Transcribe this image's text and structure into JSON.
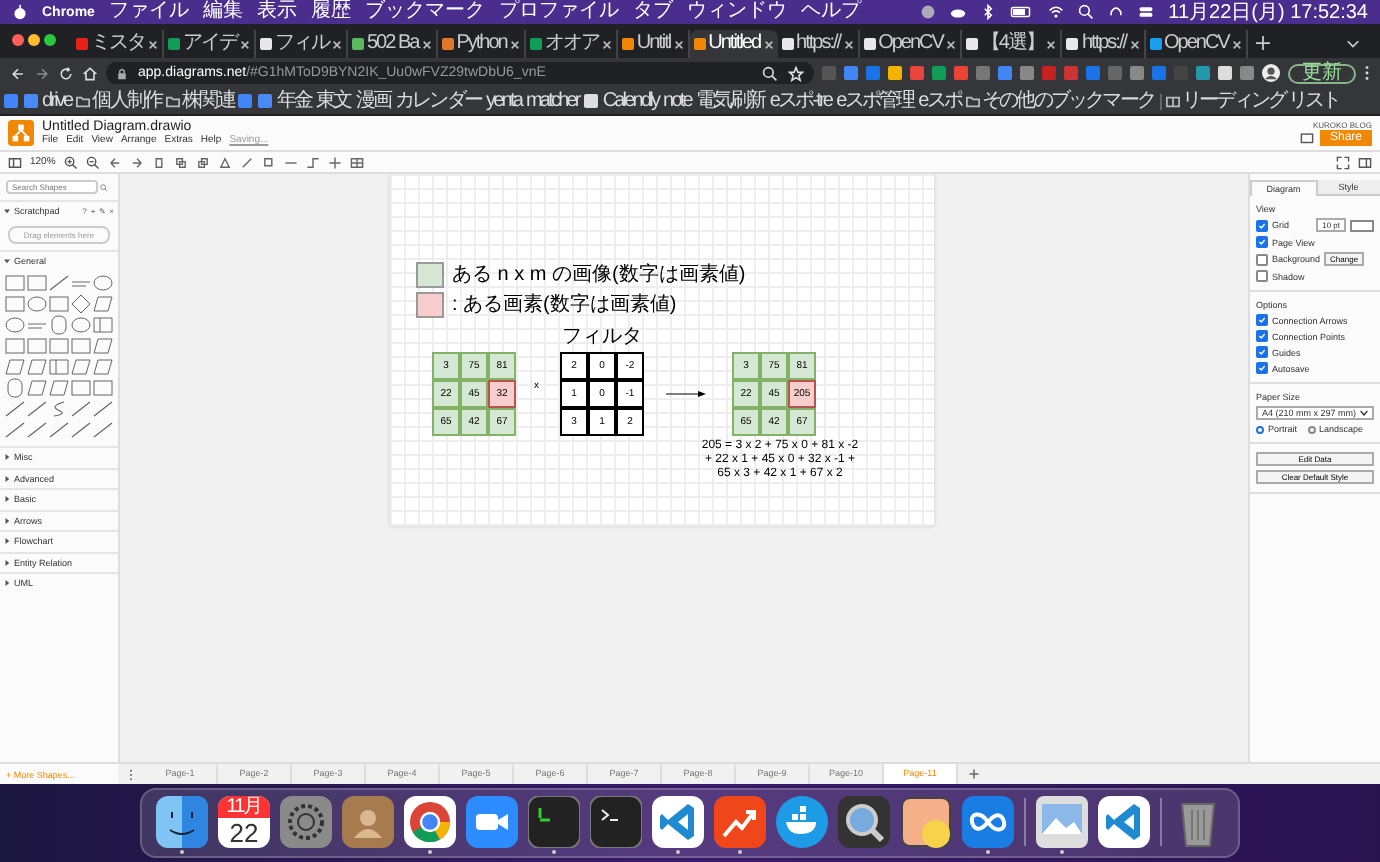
{
  "menubar": {
    "app": "Chrome",
    "items": [
      "ファイル",
      "編集",
      "表示",
      "履歴",
      "ブックマーク",
      "プロファイル",
      "タブ",
      "ウィンドウ",
      "ヘルプ"
    ],
    "clock": "11月22日(月) 17:52:34"
  },
  "tabs": [
    {
      "title": "ミスタ",
      "kind": "video",
      "selected": false
    },
    {
      "title": "アイデ",
      "kind": "sheet",
      "selected": false
    },
    {
      "title": "フィル",
      "kind": "page",
      "selected": false
    },
    {
      "title": "502 Ba",
      "kind": "face",
      "selected": false
    },
    {
      "title": "Python",
      "kind": "book",
      "selected": false
    },
    {
      "title": "オオア",
      "kind": "sheet",
      "selected": false
    },
    {
      "title": "Untitl",
      "kind": "drawio",
      "selected": false
    },
    {
      "title": "Untitled",
      "kind": "drawio",
      "selected": true
    },
    {
      "title": "https://",
      "kind": "page",
      "selected": false
    },
    {
      "title": "OpenCV",
      "kind": "page",
      "selected": false
    },
    {
      "title": "【4選】",
      "kind": "page",
      "selected": false
    },
    {
      "title": "https://",
      "kind": "page",
      "selected": false
    },
    {
      "title": "OpenCV",
      "kind": "globe",
      "selected": false
    }
  ],
  "address": {
    "host": "app.diagrams.net",
    "path": "/#G1hMToD9BYN2IK_Uu0wFVZ29twDbU6_vnE"
  },
  "update_button": "更新",
  "bookmarks": [
    {
      "kind": "icon"
    },
    {
      "kind": "icon"
    },
    {
      "kind": "link",
      "label": "drive"
    },
    {
      "kind": "folder",
      "label": "個人制作"
    },
    {
      "kind": "folder",
      "label": "株関連"
    },
    {
      "kind": "icon"
    },
    {
      "kind": "icon"
    },
    {
      "kind": "link",
      "label": "年金"
    },
    {
      "kind": "link",
      "label": "東文"
    },
    {
      "kind": "link",
      "label": "漫画"
    },
    {
      "kind": "link",
      "label": "カレンダー"
    },
    {
      "kind": "link",
      "label": "yenta"
    },
    {
      "kind": "link",
      "label": "matcher"
    },
    {
      "kind": "icon"
    },
    {
      "kind": "link",
      "label": "Calendly"
    },
    {
      "kind": "link",
      "label": "note"
    },
    {
      "kind": "link",
      "label": "電気刷新"
    },
    {
      "kind": "link",
      "label": "eスポ-tre"
    },
    {
      "kind": "link",
      "label": "eスポ管理"
    },
    {
      "kind": "link",
      "label": "eスポ"
    },
    {
      "kind": "folder",
      "label": "その他のブックマーク"
    },
    {
      "kind": "reading",
      "label": "リーディング リスト"
    }
  ],
  "app": {
    "title": "Untitled Diagram.drawio",
    "menu": [
      "File",
      "Edit",
      "View",
      "Arrange",
      "Extras",
      "Help"
    ],
    "status": "Saving...",
    "user": "KUROKO BLOG",
    "share": "Share",
    "zoom": "120%"
  },
  "shapes_panel": {
    "search_placeholder": "Search Shapes",
    "scratchpad": {
      "title": "Scratchpad",
      "controls": [
        "?",
        "+",
        "✎",
        "×"
      ],
      "drop_hint": "Drag elements here"
    },
    "sections": [
      {
        "title": "General",
        "expanded": true
      },
      {
        "title": "Misc",
        "expanded": false
      },
      {
        "title": "Advanced",
        "expanded": false
      },
      {
        "title": "Basic",
        "expanded": false
      },
      {
        "title": "Arrows",
        "expanded": false
      },
      {
        "title": "Flowchart",
        "expanded": false
      },
      {
        "title": "Entity Relation",
        "expanded": false
      },
      {
        "title": "UML",
        "expanded": false
      }
    ],
    "more_shapes": "+ More Shapes..."
  },
  "diagram": {
    "legend": [
      {
        "text": "ある n x m の画像(数字は画素値)",
        "color": "#d5e8d4"
      },
      {
        "text": ": ある画素(数字は画素値)",
        "color": "#f8cecc"
      }
    ],
    "filter_label": "フィルタ",
    "operator": "x",
    "matrices": [
      {
        "kind": "image",
        "rows": [
          [
            {
              "value": "3",
              "highlighted": false
            },
            {
              "value": "75",
              "highlighted": false
            },
            {
              "value": "81",
              "highlighted": false
            }
          ],
          [
            {
              "value": "22",
              "highlighted": false
            },
            {
              "value": "45",
              "highlighted": false
            },
            {
              "value": "32",
              "highlighted": true
            }
          ],
          [
            {
              "value": "65",
              "highlighted": false
            },
            {
              "value": "42",
              "highlighted": false
            },
            {
              "value": "67",
              "highlighted": false
            }
          ]
        ]
      },
      {
        "kind": "filter",
        "rows": [
          [
            {
              "value": "2",
              "highlighted": false
            },
            {
              "value": "0",
              "highlighted": false
            },
            {
              "value": "-2",
              "highlighted": false
            }
          ],
          [
            {
              "value": "1",
              "highlighted": false
            },
            {
              "value": "0",
              "highlighted": false
            },
            {
              "value": "-1",
              "highlighted": false
            }
          ],
          [
            {
              "value": "3",
              "highlighted": false
            },
            {
              "value": "1",
              "highlighted": false
            },
            {
              "value": "2",
              "highlighted": false
            }
          ]
        ]
      },
      {
        "kind": "image",
        "rows": [
          [
            {
              "value": "3",
              "highlighted": false
            },
            {
              "value": "75",
              "highlighted": false
            },
            {
              "value": "81",
              "highlighted": false
            }
          ],
          [
            {
              "value": "22",
              "highlighted": false
            },
            {
              "value": "45",
              "highlighted": false
            },
            {
              "value": "205",
              "highlighted": true
            }
          ],
          [
            {
              "value": "65",
              "highlighted": false
            },
            {
              "value": "42",
              "highlighted": false
            },
            {
              "value": "67",
              "highlighted": false
            }
          ]
        ]
      }
    ],
    "formula": [
      "205 = 3 x 2 + 75 x 0 + 81 x -2",
      "+ 22 x 1 + 45 x 0 + 32 x -1 +",
      "65 x 3 + 42 x 1 + 67 x 2"
    ]
  },
  "format_panel": {
    "tabs": [
      {
        "label": "Diagram",
        "selected": true
      },
      {
        "label": "Style",
        "selected": false
      }
    ],
    "view_title": "View",
    "view": [
      {
        "label": "Grid",
        "checked": true,
        "kind": "grid",
        "value": "10 pt"
      },
      {
        "label": "Page View",
        "checked": true,
        "kind": "plain"
      },
      {
        "label": "Background",
        "checked": false,
        "kind": "button",
        "button": "Change"
      },
      {
        "label": "Shadow",
        "checked": false,
        "kind": "plain"
      }
    ],
    "options_title": "Options",
    "options": [
      {
        "label": "Connection Arrows",
        "checked": true
      },
      {
        "label": "Connection Points",
        "checked": true
      },
      {
        "label": "Guides",
        "checked": true
      },
      {
        "label": "Autosave",
        "checked": true
      }
    ],
    "paper_title": "Paper Size",
    "paper": "A4 (210 mm x 297 mm)",
    "orientation": [
      {
        "label": "Portrait",
        "selected": true
      },
      {
        "label": "Landscape",
        "selected": false
      }
    ],
    "buttons": [
      "Edit Data",
      "Clear Default Style"
    ]
  },
  "pages": [
    {
      "label": "Page-1",
      "selected": false
    },
    {
      "label": "Page-2",
      "selected": false
    },
    {
      "label": "Page-3",
      "selected": false
    },
    {
      "label": "Page-4",
      "selected": false
    },
    {
      "label": "Page-5",
      "selected": false
    },
    {
      "label": "Page-6",
      "selected": false
    },
    {
      "label": "Page-7",
      "selected": false
    },
    {
      "label": "Page-8",
      "selected": false
    },
    {
      "label": "Page-9",
      "selected": false
    },
    {
      "label": "Page-10",
      "selected": false
    },
    {
      "label": "Page-11",
      "selected": true
    }
  ],
  "dock": [
    {
      "kind": "finder",
      "running": true
    },
    {
      "kind": "calendar",
      "month": "11月",
      "day": "22",
      "running": false
    },
    {
      "kind": "settings",
      "running": false
    },
    {
      "kind": "contacts",
      "running": false
    },
    {
      "kind": "browser",
      "running": true
    },
    {
      "kind": "video",
      "running": false
    },
    {
      "kind": "terminal-green",
      "running": true
    },
    {
      "kind": "terminal",
      "running": false
    },
    {
      "kind": "editor",
      "running": true
    },
    {
      "kind": "trend",
      "running": true
    },
    {
      "kind": "whale",
      "running": false
    },
    {
      "kind": "lens",
      "running": false
    },
    {
      "kind": "sticker",
      "running": false
    },
    {
      "kind": "infinity",
      "running": true
    },
    {
      "kind": "separator"
    },
    {
      "kind": "photo",
      "running": true
    },
    {
      "kind": "editor",
      "running": false
    },
    {
      "kind": "separator"
    },
    {
      "kind": "trash",
      "running": false
    }
  ]
}
